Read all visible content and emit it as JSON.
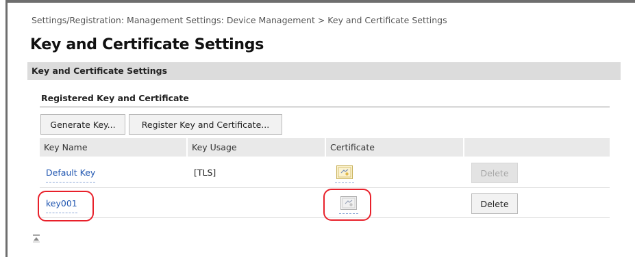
{
  "breadcrumb": "Settings/Registration: Management Settings: Device Management > Key and Certificate Settings",
  "page_title": "Key and Certificate Settings",
  "section": {
    "title": "Key and Certificate Settings",
    "subheading": "Registered Key and Certificate",
    "buttons": {
      "generate_key": "Generate Key...",
      "register": "Register Key and Certificate..."
    },
    "table": {
      "columns": [
        "Key Name",
        "Key Usage",
        "Certificate",
        ""
      ],
      "rows": [
        {
          "key_name": "Default Key",
          "key_usage": "[TLS]",
          "certificate_icon": "certificate-icon",
          "delete_label": "Delete",
          "delete_enabled": false
        },
        {
          "key_name": "key001",
          "key_usage": "",
          "certificate_icon": "certificate-icon",
          "delete_label": "Delete",
          "delete_enabled": true
        }
      ]
    }
  },
  "annotation_color": "#e8202a",
  "link_color": "#1f55b0",
  "icons": {
    "back_to_top": "scroll-to-top-icon"
  }
}
